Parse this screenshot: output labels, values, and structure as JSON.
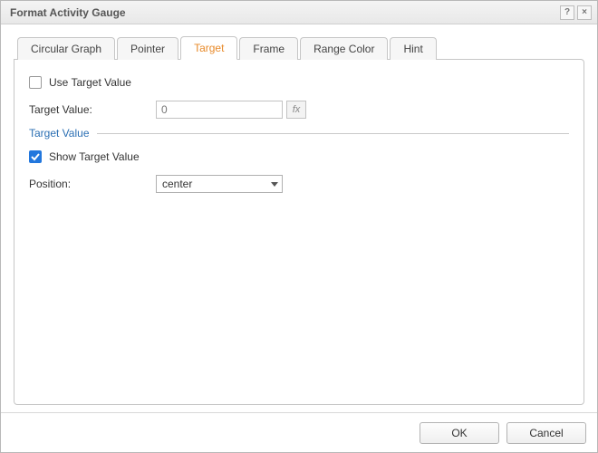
{
  "dialog": {
    "title": "Format Activity Gauge"
  },
  "tabs": [
    {
      "label": "Circular Graph",
      "active": false
    },
    {
      "label": "Pointer",
      "active": false
    },
    {
      "label": "Target",
      "active": true
    },
    {
      "label": "Frame",
      "active": false
    },
    {
      "label": "Range Color",
      "active": false
    },
    {
      "label": "Hint",
      "active": false
    }
  ],
  "target_tab": {
    "use_target_value_label": "Use Target Value",
    "use_target_value_checked": false,
    "target_value_label": "Target Value:",
    "target_value_placeholder": "0",
    "fx_label": "fx",
    "section_title": "Target Value",
    "show_target_value_label": "Show Target Value",
    "show_target_value_checked": true,
    "position_label": "Position:",
    "position_value": "center",
    "position_options": [
      "center"
    ]
  },
  "footer": {
    "ok_label": "OK",
    "cancel_label": "Cancel"
  },
  "titlebar_icons": {
    "help": "?",
    "close": "×"
  }
}
